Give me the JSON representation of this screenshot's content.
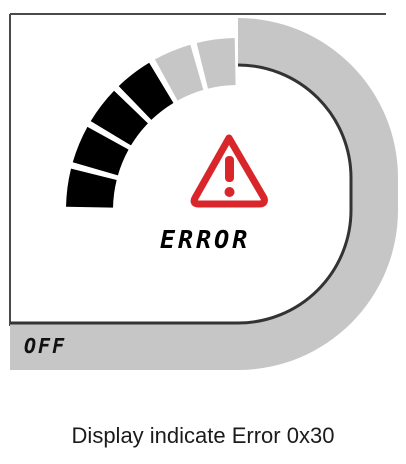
{
  "display": {
    "status_text": "ERROR",
    "mode_text": "OFF",
    "warning_icon": "warning-triangle-icon",
    "gauge": {
      "segments_total": 6,
      "segments_active": 4,
      "active_color": "#000000",
      "inactive_color": "#c6c6c6",
      "ring_color": "#c6c6c6",
      "inner_line_color": "#333333"
    },
    "warning_color": "#d8262a",
    "frame_color": "#4a4a4a"
  },
  "caption": "Display indicate Error 0x30"
}
